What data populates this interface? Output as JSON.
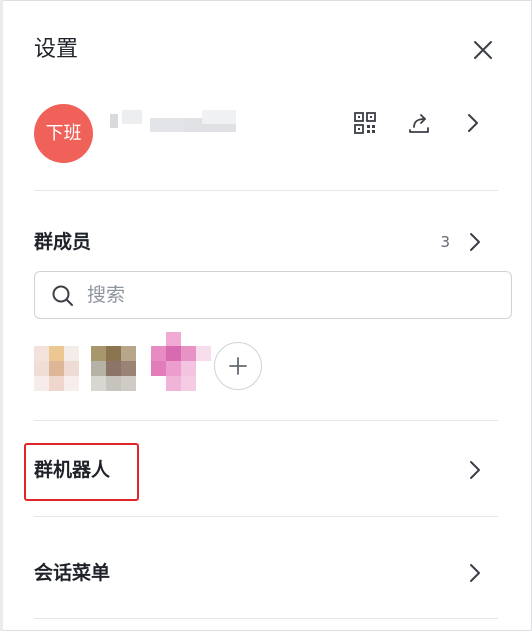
{
  "header": {
    "title": "设置"
  },
  "profile": {
    "avatar_text": "下班",
    "avatar_color": "#f0615a"
  },
  "members": {
    "label": "群成员",
    "count": "3"
  },
  "search": {
    "placeholder": "搜索"
  },
  "menu": {
    "bots_label": "群机器人",
    "session_menu_label": "会话菜单"
  },
  "colors": {
    "highlight": "#e1262b",
    "divider": "#e4e6ea",
    "text": "#1f2329"
  }
}
